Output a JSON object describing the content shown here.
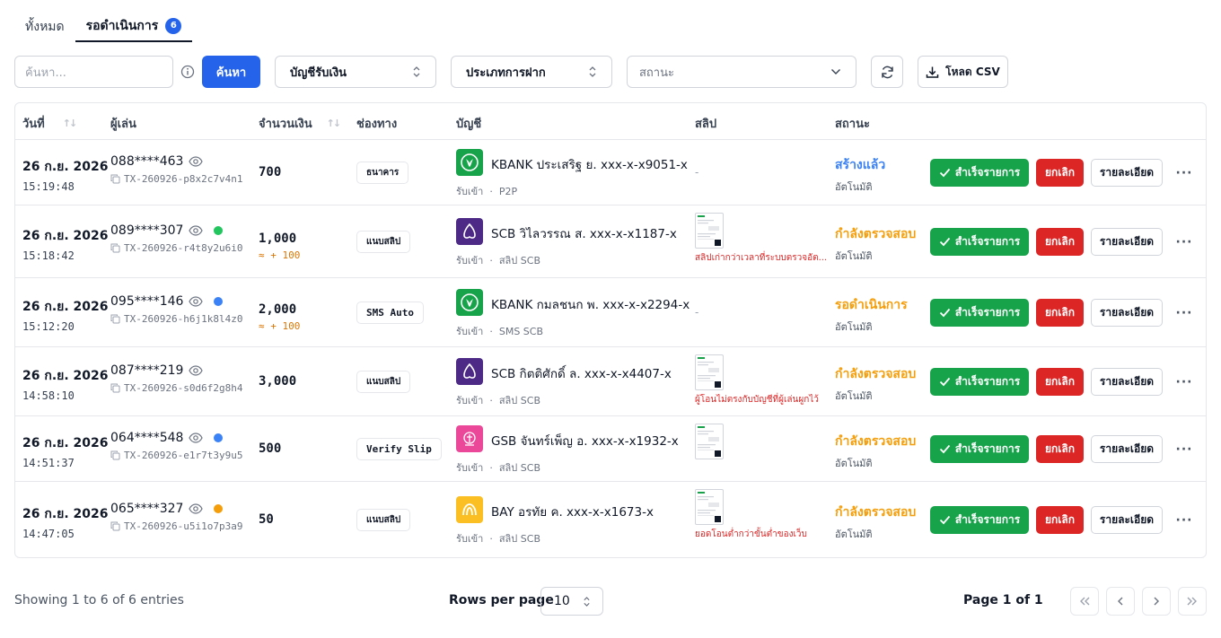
{
  "tabs": [
    {
      "label": "ทั้งหมด"
    },
    {
      "label": "รอดำเนินการ",
      "badge": "6"
    }
  ],
  "toolbar": {
    "search_placeholder": "ค้นหา...",
    "search_button": "ค้นหา",
    "account_select": "บัญชีรับเงิน",
    "deposit_type_select": "ประเภทการฝาก",
    "status_select_placeholder": "สถานะ",
    "csv_button": "โหลด CSV"
  },
  "columns": {
    "date": "วันที่",
    "player": "ผู้เล่น",
    "amount": "จำนวนเงิน",
    "channel": "ช่องทาง",
    "account": "บัญชี",
    "slip": "สลิป",
    "status": "สถานะ"
  },
  "action_labels": {
    "approve": "สำเร็จรายการ",
    "cancel": "ยกเลิก",
    "detail": "รายละเอียด",
    "more": "···"
  },
  "colors": {
    "primary": "#2563eb",
    "success": "#16a34a",
    "danger": "#dc2626",
    "status_created": "#3b82f6",
    "status_pending": "#f59e0b",
    "kbank": "#16a34a",
    "scb": "#4c2a85",
    "gsb": "#ec4899",
    "bay": "#fbbf24"
  },
  "rows": [
    {
      "date": "26 ก.ย. 2026",
      "time": "15:19:48",
      "player": "088****463",
      "dot": "",
      "tx": "TX-260926-p8x2c7v4n1",
      "amount": "700",
      "bonus": "",
      "channel": "ธนาคาร",
      "channel_mono": false,
      "bank": "kbank",
      "account": "KBANK ประเสริฐ ย. xxx-x-x9051-x",
      "account_sub_a": "รับเข้า",
      "account_sub_b": "P2P",
      "slip": false,
      "slip_text": "-",
      "slip_note": "",
      "status": "สร้างแล้ว",
      "status_color": "#3b82f6",
      "status_sub": "อัตโนมัติ"
    },
    {
      "date": "26 ก.ย. 2026",
      "time": "15:18:42",
      "player": "089****307",
      "dot": "#22c55e",
      "tx": "TX-260926-r4t8y2u6i0",
      "amount": "1,000",
      "bonus": "≈ + 100",
      "channel": "แนบสลิป",
      "channel_mono": false,
      "bank": "scb",
      "account": "SCB วิไลวรรณ ส. xxx-x-x1187-x",
      "account_sub_a": "รับเข้า",
      "account_sub_b": "สลิป SCB",
      "slip": true,
      "slip_text": "",
      "slip_note": "สลิปเก่ากว่าเวลาที่ระบบตรวจอัต...",
      "status": "กำลังตรวจสอบ",
      "status_color": "#f59e0b",
      "status_sub": "อัตโนมัติ"
    },
    {
      "date": "26 ก.ย. 2026",
      "time": "15:12:20",
      "player": "095****146",
      "dot": "#3b82f6",
      "tx": "TX-260926-h6j1k8l4z0",
      "amount": "2,000",
      "bonus": "≈ + 100",
      "channel": "SMS Auto",
      "channel_mono": true,
      "bank": "kbank",
      "account": "KBANK กมลชนก พ. xxx-x-x2294-x",
      "account_sub_a": "รับเข้า",
      "account_sub_b": "SMS SCB",
      "slip": false,
      "slip_text": "-",
      "slip_note": "",
      "status": "รอดำเนินการ",
      "status_color": "#f59e0b",
      "status_sub": "อัตโนมัติ"
    },
    {
      "date": "26 ก.ย. 2026",
      "time": "14:58:10",
      "player": "087****219",
      "dot": "",
      "tx": "TX-260926-s0d6f2g8h4",
      "amount": "3,000",
      "bonus": "",
      "channel": "แนบสลิป",
      "channel_mono": false,
      "bank": "scb",
      "account": "SCB กิตติศักดิ์ ล. xxx-x-x4407-x",
      "account_sub_a": "รับเข้า",
      "account_sub_b": "สลิป SCB",
      "slip": true,
      "slip_text": "",
      "slip_note": "ผู้โอนไม่ตรงกับบัญชีที่ผู้เล่นผูกไว้",
      "status": "กำลังตรวจสอบ",
      "status_color": "#f59e0b",
      "status_sub": "อัตโนมัติ"
    },
    {
      "date": "26 ก.ย. 2026",
      "time": "14:51:37",
      "player": "064****548",
      "dot": "#3b82f6",
      "tx": "TX-260926-e1r7t3y9u5",
      "amount": "500",
      "bonus": "",
      "channel": "Verify Slip",
      "channel_mono": true,
      "bank": "gsb",
      "account": "GSB จันทร์เพ็ญ อ. xxx-x-x1932-x",
      "account_sub_a": "รับเข้า",
      "account_sub_b": "สลิป SCB",
      "slip": true,
      "slip_text": "",
      "slip_note": "",
      "status": "กำลังตรวจสอบ",
      "status_color": "#f59e0b",
      "status_sub": "อัตโนมัติ"
    },
    {
      "date": "26 ก.ย. 2026",
      "time": "14:47:05",
      "player": "065****327",
      "dot": "#f59e0b",
      "tx": "TX-260926-u5i1o7p3a9",
      "amount": "50",
      "bonus": "",
      "channel": "แนบสลิป",
      "channel_mono": false,
      "bank": "bay",
      "account": "BAY อรทัย ค. xxx-x-x1673-x",
      "account_sub_a": "รับเข้า",
      "account_sub_b": "สลิป SCB",
      "slip": true,
      "slip_text": "",
      "slip_note": "ยอดโอนต่ำกว่าขั้นต่ำของเว็บ",
      "status": "กำลังตรวจสอบ",
      "status_color": "#f59e0b",
      "status_sub": "อัตโนมัติ"
    }
  ],
  "footer": {
    "showing": "Showing 1 to 6 of 6 entries",
    "rows_per_page_label": "Rows per page",
    "rows_per_page_value": "10",
    "page_label": "Page 1 of 1"
  },
  "pagination_icons": [
    "first-page-icon",
    "previous-page-icon",
    "next-page-icon",
    "last-page-icon"
  ]
}
